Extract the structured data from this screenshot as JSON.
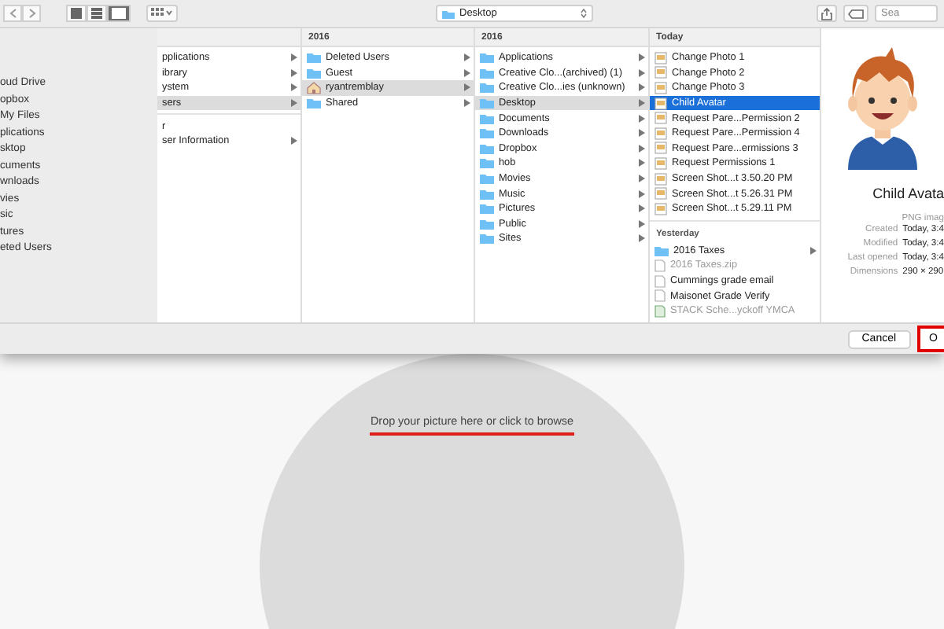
{
  "toolbar": {
    "view_modes": [
      {
        "kind": "icon",
        "selected": false
      },
      {
        "kind": "list",
        "selected": false
      },
      {
        "kind": "column",
        "selected": true
      }
    ],
    "path": "Desktop",
    "search": {
      "placeholder": "Sea"
    }
  },
  "sidebar": {
    "items": [
      {
        "label": "oud Drive"
      },
      {
        "label": "opbox"
      },
      {
        "label": "My Files"
      },
      {
        "label": "plications"
      },
      {
        "label": "sktop"
      },
      {
        "label": "cuments"
      },
      {
        "label": "wnloads"
      },
      {
        "label": "vies"
      },
      {
        "label": "sic"
      },
      {
        "label": "tures"
      },
      {
        "label": "eted Users"
      }
    ]
  },
  "columns": [
    {
      "focused": false,
      "groups": [
        {
          "items": [
            {
              "label": "pplications",
              "kind": "plain",
              "selected": false,
              "expandable": true,
              "disabled": false
            },
            {
              "label": "ibrary",
              "kind": "plain",
              "selected": false,
              "expandable": true,
              "disabled": false
            },
            {
              "label": "ystem",
              "kind": "plain",
              "selected": false,
              "expandable": true,
              "disabled": false
            },
            {
              "label": "sers",
              "kind": "plain",
              "selected": true,
              "expandable": true,
              "disabled": false
            }
          ]
        },
        {
          "items": [
            {
              "label": "r",
              "kind": "plain",
              "selected": false,
              "expandable": false,
              "disabled": false
            },
            {
              "label": "ser Information",
              "kind": "plain",
              "selected": false,
              "expandable": true,
              "disabled": false
            }
          ]
        }
      ]
    },
    {
      "header": "2016",
      "focused": false,
      "groups": [
        {
          "items": [
            {
              "label": "Deleted Users",
              "kind": "folder",
              "selected": false,
              "expandable": true,
              "disabled": false
            },
            {
              "label": "Guest",
              "kind": "folder",
              "selected": false,
              "expandable": true,
              "disabled": false
            },
            {
              "label": "ryantremblay",
              "kind": "home",
              "selected": true,
              "expandable": true,
              "disabled": false
            },
            {
              "label": "Shared",
              "kind": "folder",
              "selected": false,
              "expandable": true,
              "disabled": false
            }
          ]
        }
      ]
    },
    {
      "header": "2016",
      "focused": false,
      "groups": [
        {
          "items": [
            {
              "label": "Applications",
              "kind": "folder",
              "selected": false,
              "expandable": true,
              "disabled": false
            },
            {
              "label": "Creative Clo...(archived) (1)",
              "kind": "folder",
              "selected": false,
              "expandable": true,
              "disabled": false
            },
            {
              "label": "Creative Clo...ies (unknown)",
              "kind": "folder",
              "selected": false,
              "expandable": true,
              "disabled": false
            },
            {
              "label": "Desktop",
              "kind": "folder",
              "selected": true,
              "expandable": true,
              "disabled": false
            },
            {
              "label": "Documents",
              "kind": "folder",
              "selected": false,
              "expandable": true,
              "disabled": false
            },
            {
              "label": "Downloads",
              "kind": "folder",
              "selected": false,
              "expandable": true,
              "disabled": false
            },
            {
              "label": "Dropbox",
              "kind": "folder",
              "selected": false,
              "expandable": true,
              "disabled": false
            },
            {
              "label": "hob",
              "kind": "folder",
              "selected": false,
              "expandable": true,
              "disabled": false
            },
            {
              "label": "Movies",
              "kind": "folder",
              "selected": false,
              "expandable": true,
              "disabled": false
            },
            {
              "label": "Music",
              "kind": "folder",
              "selected": false,
              "expandable": true,
              "disabled": false
            },
            {
              "label": "Pictures",
              "kind": "folder",
              "selected": false,
              "expandable": true,
              "disabled": false
            },
            {
              "label": "Public",
              "kind": "folder",
              "selected": false,
              "expandable": true,
              "disabled": false
            },
            {
              "label": "Sites",
              "kind": "folder",
              "selected": false,
              "expandable": true,
              "disabled": false
            }
          ]
        }
      ]
    },
    {
      "header": "Today",
      "focused": true,
      "groups": [
        {
          "items": [
            {
              "label": "Change Photo 1",
              "kind": "image",
              "selected": false,
              "expandable": false,
              "disabled": false
            },
            {
              "label": "Change Photo 2",
              "kind": "image",
              "selected": false,
              "expandable": false,
              "disabled": false
            },
            {
              "label": "Change Photo 3",
              "kind": "image",
              "selected": false,
              "expandable": false,
              "disabled": false
            },
            {
              "label": "Child Avatar",
              "kind": "image",
              "selected": true,
              "expandable": false,
              "disabled": false
            },
            {
              "label": "Request Pare...Permission 2",
              "kind": "image",
              "selected": false,
              "expandable": false,
              "disabled": false
            },
            {
              "label": "Request Pare...Permission 4",
              "kind": "image",
              "selected": false,
              "expandable": false,
              "disabled": false
            },
            {
              "label": "Request Pare...ermissions 3",
              "kind": "image",
              "selected": false,
              "expandable": false,
              "disabled": false
            },
            {
              "label": "Request Permissions 1",
              "kind": "image",
              "selected": false,
              "expandable": false,
              "disabled": false
            },
            {
              "label": "Screen Shot...t 3.50.20 PM",
              "kind": "image",
              "selected": false,
              "expandable": false,
              "disabled": false
            },
            {
              "label": "Screen Shot...t 5.26.31 PM",
              "kind": "image",
              "selected": false,
              "expandable": false,
              "disabled": false
            },
            {
              "label": "Screen Shot...t 5.29.11 PM",
              "kind": "image",
              "selected": false,
              "expandable": false,
              "disabled": false
            }
          ]
        },
        {
          "label": "Yesterday",
          "items": [
            {
              "label": "2016 Taxes",
              "kind": "folder",
              "selected": false,
              "expandable": true,
              "disabled": false
            },
            {
              "label": "2016 Taxes.zip",
              "kind": "doc",
              "selected": false,
              "expandable": false,
              "disabled": true
            },
            {
              "label": "Cummings grade email",
              "kind": "doc",
              "selected": false,
              "expandable": false,
              "disabled": false
            },
            {
              "label": "Maisonet Grade Verify",
              "kind": "doc",
              "selected": false,
              "expandable": false,
              "disabled": false
            },
            {
              "label": "STACK Sche...yckoff YMCA",
              "kind": "sheet",
              "selected": false,
              "expandable": false,
              "disabled": true
            }
          ]
        }
      ]
    }
  ],
  "preview": {
    "title": "Child Avata",
    "type": "PNG imag",
    "details": [
      {
        "label": "Created",
        "value": "Today, 3:4"
      },
      {
        "label": "Modified",
        "value": "Today, 3:4"
      },
      {
        "label": "Last opened",
        "value": "Today, 3:4"
      },
      {
        "label": "Dimensions",
        "value": "290 × 290"
      }
    ]
  },
  "buttons": [
    {
      "label": "Cancel",
      "highlighted": false
    },
    {
      "label": "O",
      "highlighted": true
    }
  ],
  "drop_zone": {
    "text": "Drop your picture here or click to browse",
    "underlined": true
  }
}
